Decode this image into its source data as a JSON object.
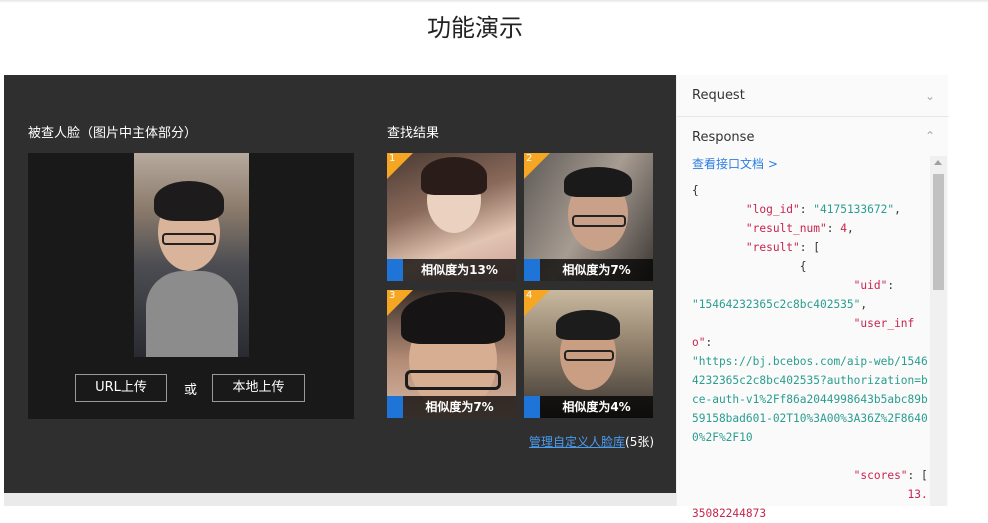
{
  "page_title": "功能演示",
  "demo": {
    "query_label": "被查人脸（图片中主体部分）",
    "result_label": "查找结果",
    "url_upload": "URL上传",
    "or_text": "或",
    "local_upload": "本地上传",
    "results": [
      {
        "rank": "1",
        "similarity": "相似度为13%"
      },
      {
        "rank": "2",
        "similarity": "相似度为7%"
      },
      {
        "rank": "3",
        "similarity": "相似度为7%"
      },
      {
        "rank": "4",
        "similarity": "相似度为4%"
      }
    ],
    "manage_link": "管理自定义人脸库",
    "manage_count": "(5张)"
  },
  "panel": {
    "request_label": "Request",
    "response_label": "Response",
    "doc_link": "查看接口文档 >",
    "json_lines": {
      "l1": "{",
      "log_id_key": "\"log_id\"",
      "log_id_val": "\"4175133672\"",
      "result_num_key": "\"result_num\"",
      "result_num_val": "4",
      "result_key": "\"result\"",
      "brace": "{",
      "uid_key": "\"uid\"",
      "uid_val": "\"15464232365c2c8bc402535\"",
      "user_info_key": "\"user_info\"",
      "user_info_val": "\"https://bj.bcebos.com/aip-web/15464232365c2c8bc402535?authorization=bce-auth-v1%2Ff86a2044998643b5abc89b59158bad601-02T10%3A00%3A36Z%2F86400%2F%2F10",
      "scores_key": "\"scores\"",
      "score_val": "13.35082244873"
    }
  }
}
